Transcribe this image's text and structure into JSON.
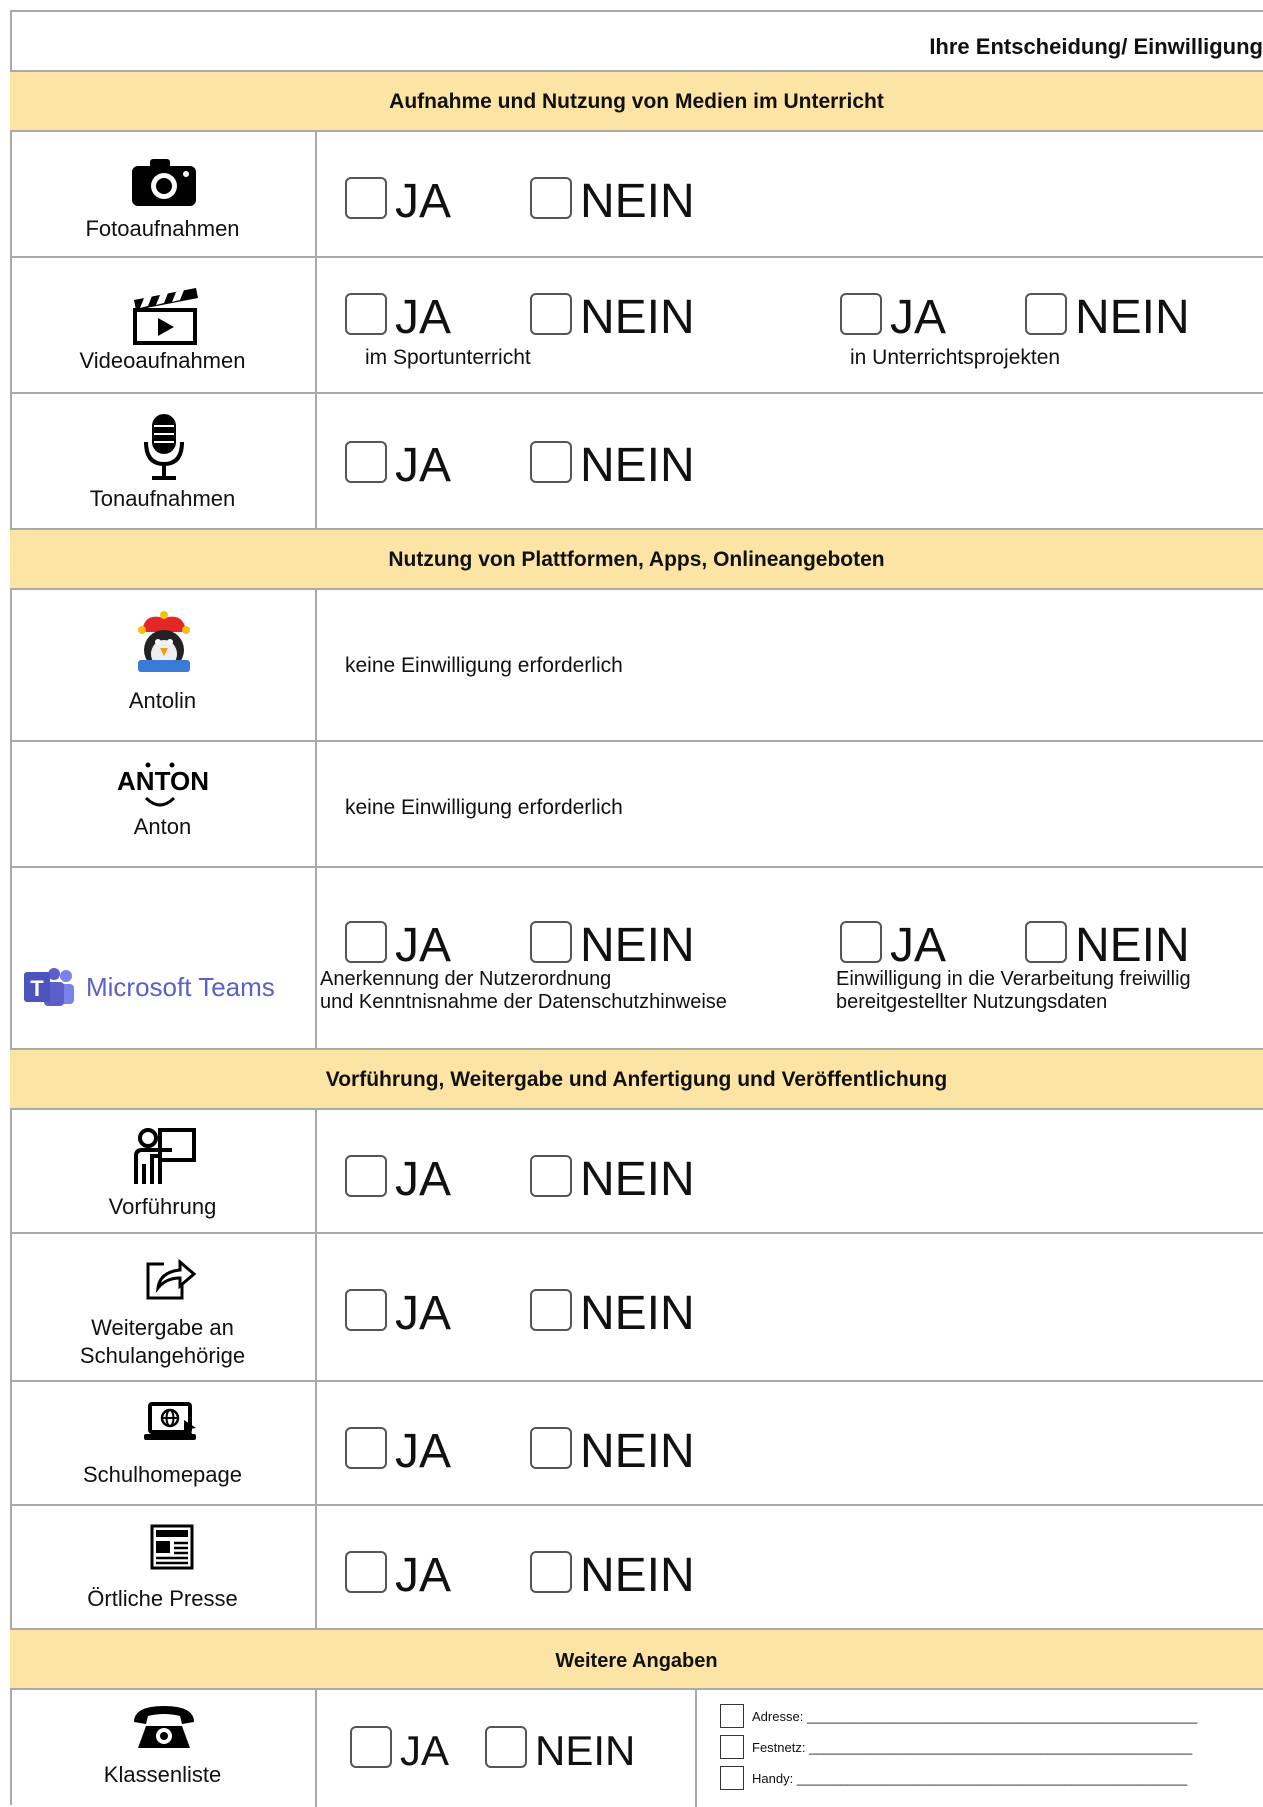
{
  "header": {
    "title": "Ihre Entscheidung/ Einwilligung"
  },
  "sections": {
    "media": "Aufnahme und Nutzung von Medien im Unterricht",
    "platforms": "Nutzung von Plattformen, Apps, Onlineangeboten",
    "publish": "Vorführung, Weitergabe und Anfertigung und Veröffentlichung",
    "further": "Weitere Angaben"
  },
  "options": {
    "yes": "JA",
    "no": "NEIN"
  },
  "rows": {
    "foto": {
      "label": "Fotoaufnahmen"
    },
    "video": {
      "label": "Videoaufnahmen",
      "sub1": "im Sportunterricht",
      "sub2": "in Unterrichtsprojekten"
    },
    "ton": {
      "label": "Tonaufnahmen"
    },
    "antolin": {
      "label": "Antolin",
      "note": "keine Einwilligung erforderlich"
    },
    "anton": {
      "label": "Anton",
      "logo": "ANTON",
      "note": "keine Einwilligung erforderlich"
    },
    "teams": {
      "logo": "Microsoft Teams",
      "sub1a": "Anerkennung der Nutzerordnung",
      "sub1b": "und Kenntnisnahme der Datenschutzhinweise",
      "sub2a": "Einwilligung in die Verarbeitung freiwillig",
      "sub2b": "bereitgestellter Nutzungsdaten"
    },
    "vorfuehrung": {
      "label": "Vorführung"
    },
    "weitergabe": {
      "label1": "Weitergabe an",
      "label2": "Schulangehörige"
    },
    "homepage": {
      "label": "Schulhomepage"
    },
    "presse": {
      "label": "Örtliche Presse"
    },
    "klassenliste": {
      "label": "Klassenliste",
      "fields": [
        "Adresse: ______________________________________________________",
        "Festnetz: _____________________________________________________",
        "Handy: ______________________________________________________"
      ]
    }
  },
  "icons": [
    "camera-icon",
    "clapperboard-icon",
    "microphone-icon",
    "antolin-penguin-icon",
    "teams-logo-icon",
    "presentation-icon",
    "share-icon",
    "web-laptop-icon",
    "newspaper-icon",
    "telephone-icon"
  ],
  "colors": {
    "section_header": "#fce4a4",
    "grid_line": "#aaaaaa",
    "teams_purple": "#5b5fc7"
  }
}
